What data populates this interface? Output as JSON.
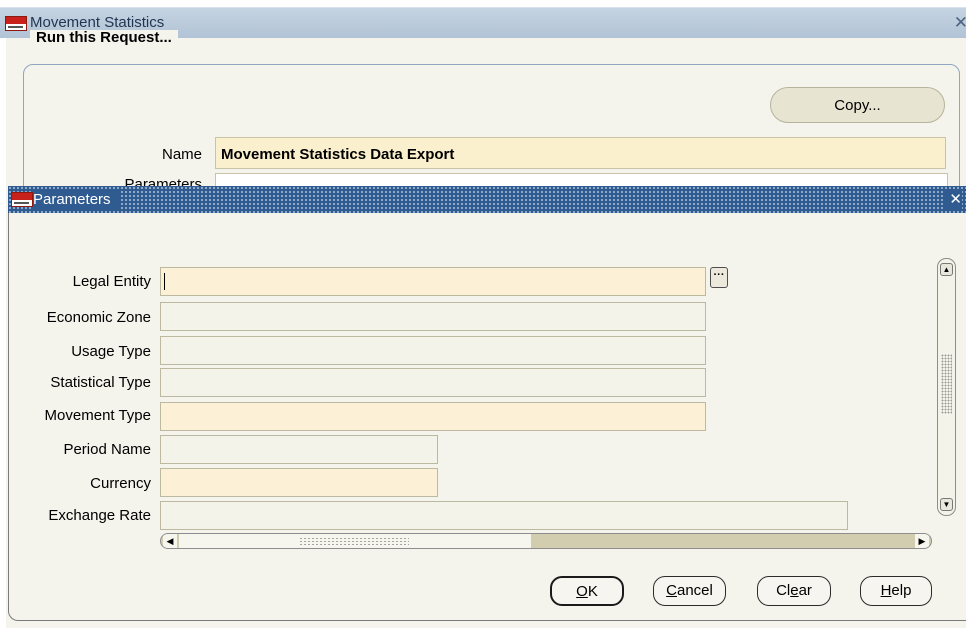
{
  "outer_window": {
    "title": "Movement Statistics",
    "close_glyph": "✕",
    "group_label": "Run this Request...",
    "copy_button": "Copy...",
    "name_label": "Name",
    "name_value": "Movement Statistics Data Export",
    "parameters_label": "Parameters"
  },
  "params_window": {
    "title": "Parameters",
    "close_glyph": "✕",
    "lov_glyph": "···",
    "fields": [
      {
        "label": "Legal Entity",
        "value": "",
        "required": true
      },
      {
        "label": "Economic Zone",
        "value": "",
        "required": false
      },
      {
        "label": "Usage Type",
        "value": "",
        "required": false
      },
      {
        "label": "Statistical Type",
        "value": "",
        "required": false
      },
      {
        "label": "Movement Type",
        "value": "",
        "required": true
      },
      {
        "label": "Period Name",
        "value": "",
        "required": false
      },
      {
        "label": "Currency",
        "value": "",
        "required": true
      },
      {
        "label": "Exchange Rate",
        "value": "",
        "required": false
      }
    ],
    "buttons": {
      "ok": {
        "mnemonic": "O",
        "rest": "K"
      },
      "cancel": {
        "mnemonic": "C",
        "rest": "ancel"
      },
      "clear": {
        "pre": "Cl",
        "mnemonic": "e",
        "rest": "ar"
      },
      "help": {
        "mnemonic": "H",
        "rest": "elp"
      }
    }
  },
  "icons": {
    "app_logo": "oracle-applications-logo",
    "scroll_up": "scroll-up-arrow-icon",
    "scroll_down": "scroll-down-arrow-icon",
    "scroll_left": "scroll-left-arrow-icon",
    "scroll_right": "scroll-right-arrow-icon"
  },
  "colors": {
    "required_field": "#fcf0d6",
    "optional_field": "#f4f3ea",
    "params_titlebar": "#2f5b91",
    "outer_titlebar": "#b9c9da",
    "body_bg": "#f5f4ec"
  }
}
